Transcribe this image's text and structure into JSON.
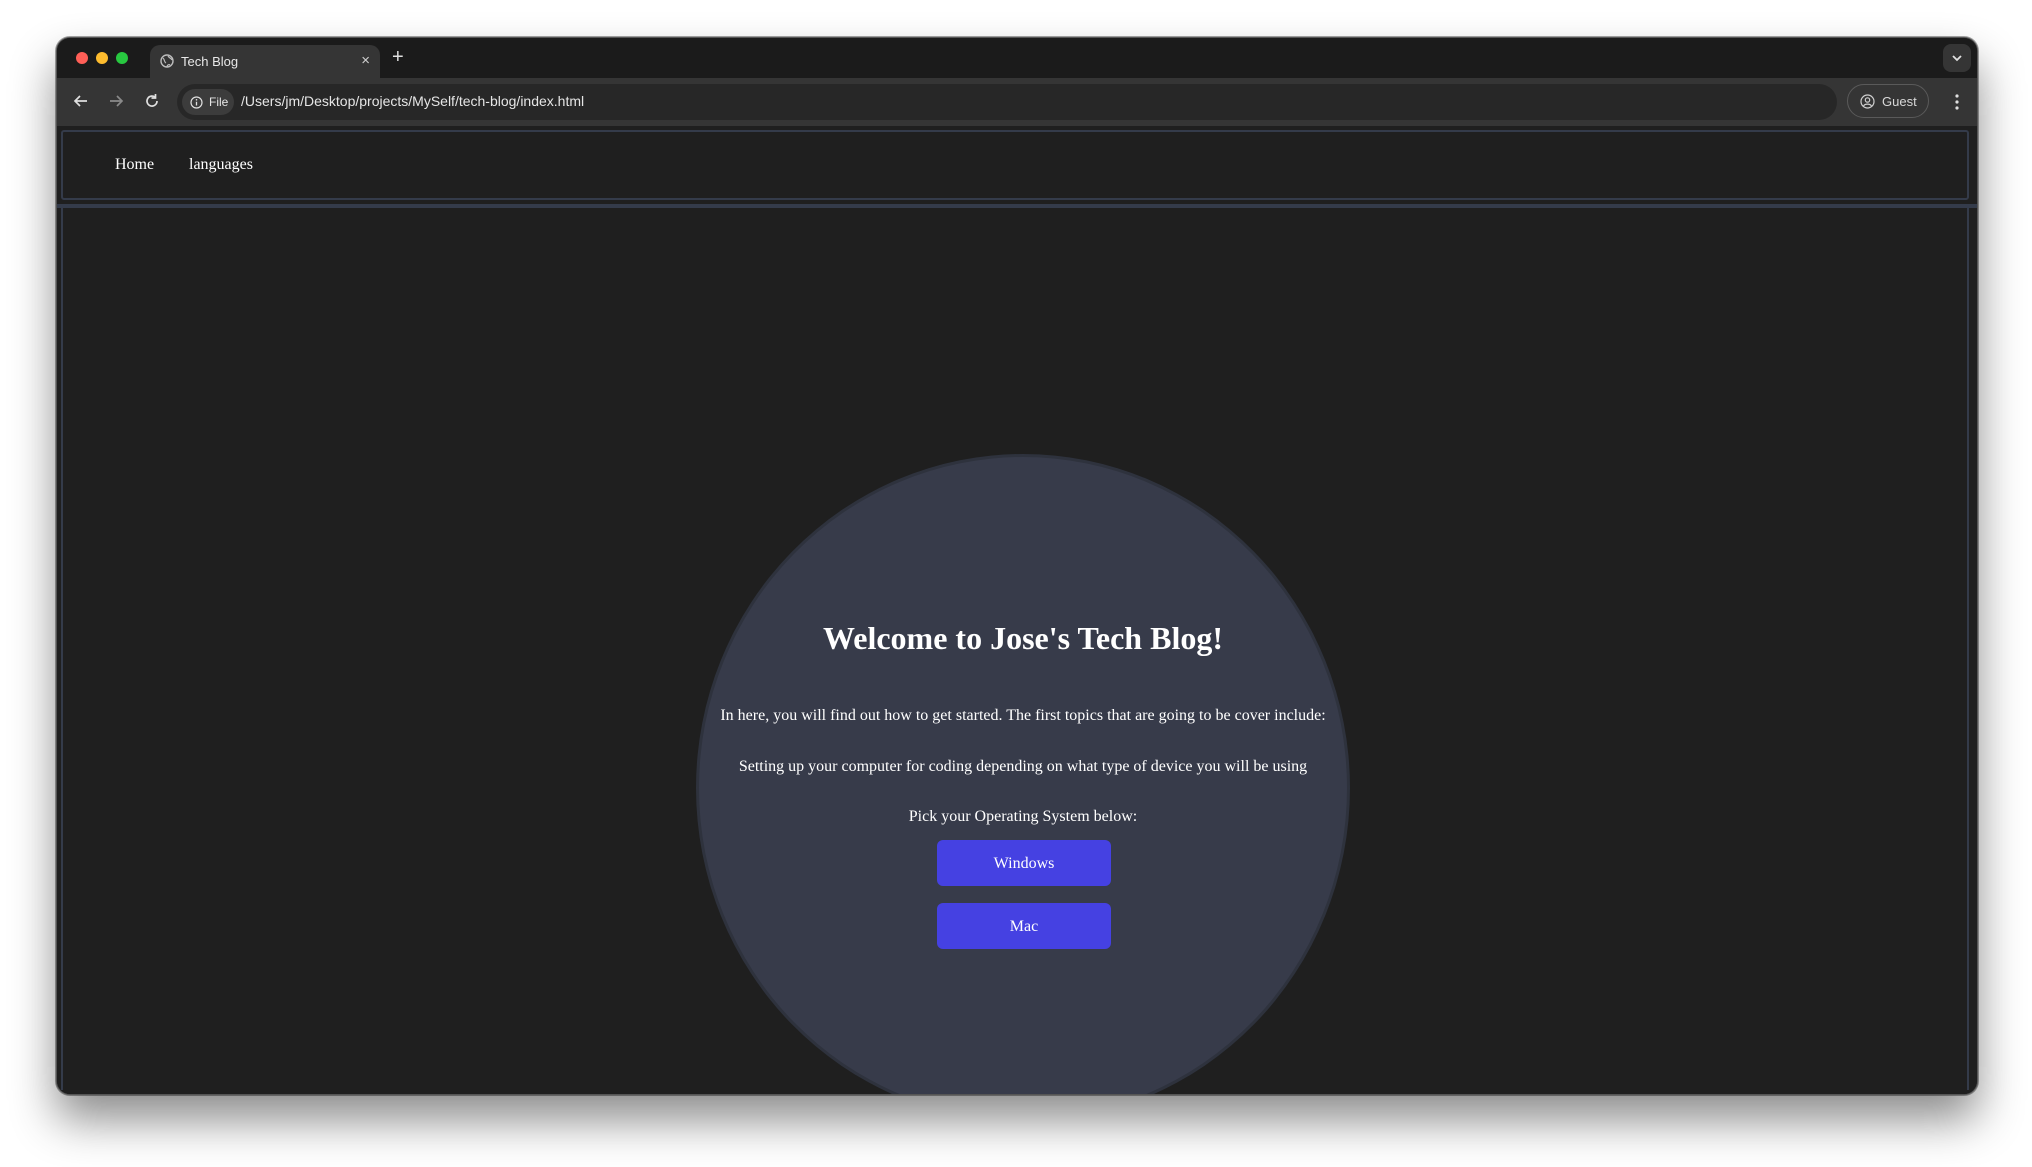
{
  "browser": {
    "tab_title": "Tech Blog",
    "new_tab_symbol": "+",
    "close_symbol": "×",
    "file_chip_label": "File",
    "url": "/Users/jm/Desktop/projects/MySelf/tech-blog/index.html",
    "profile_label": "Guest"
  },
  "nav": {
    "home": "Home",
    "languages": "languages"
  },
  "hero": {
    "title": "Welcome to Jose's Tech Blog!",
    "intro": "In here, you will find out how to get started. The first topics that are going to be cover include:",
    "topic": "Setting up your computer for coding depending on what type of device you will be using",
    "prompt": "Pick your Operating System below:",
    "buttons": {
      "windows": "Windows",
      "mac": "Mac"
    }
  },
  "colors": {
    "page_background": "#1f1f1f",
    "circle_background": "#373b4a",
    "button_background": "#4541e2",
    "border": "#343b4a"
  }
}
